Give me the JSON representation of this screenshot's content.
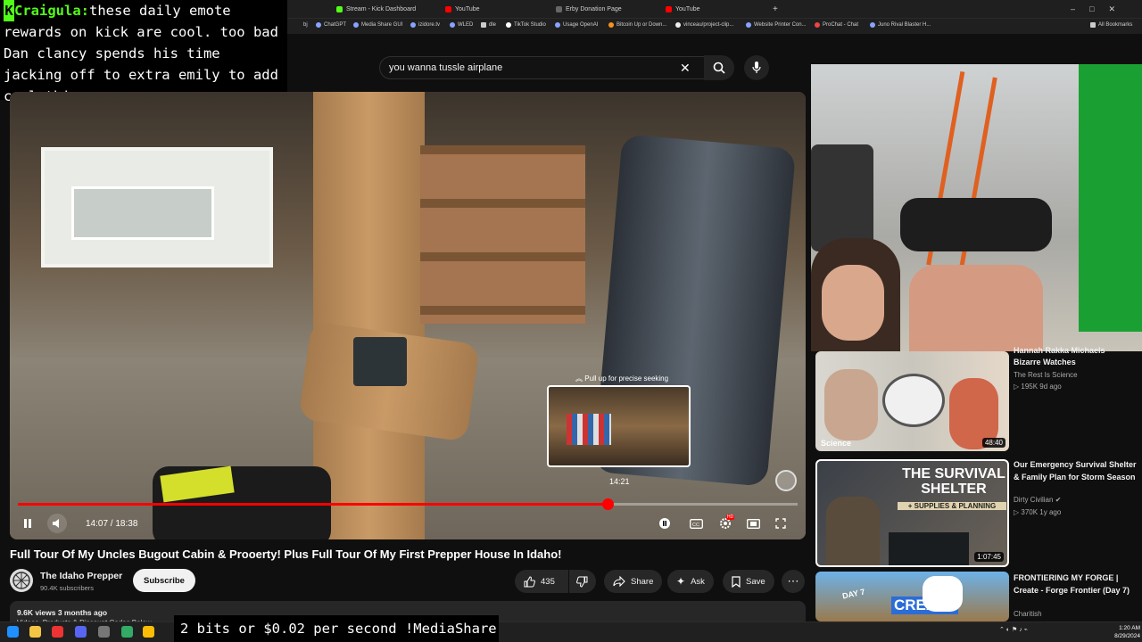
{
  "browser": {
    "tabs": [
      {
        "label": "Stream - Kick Dashboard",
        "color": "#53fc18"
      },
      {
        "label": "YouTube",
        "color": "#ff0000"
      },
      {
        "label": "Erby Donation Page",
        "color": "#888888"
      },
      {
        "label": "YouTube",
        "color": "#ff0000"
      }
    ],
    "bookmarks": [
      "bj",
      "ChatGPT",
      "Media Share GUI",
      "izidore.tv",
      "WLED",
      "dle",
      "TikTok Studio",
      "Usage  OpenAI",
      "Bitcoin Up or Down...",
      "vinceau/project-clip...",
      "Website Printer Con...",
      "ProChat - Chat",
      "Juno Rival Blaster H..."
    ],
    "all_bookmarks": "All Bookmarks"
  },
  "chat": {
    "username": "Craigula:",
    "message": "these daily emote rewards on kick are cool. too bad Dan clancy spends his time jacking off to extra emily to add cool things"
  },
  "search": {
    "query": "you wanna tussle airplane"
  },
  "player": {
    "time": "14:07 / 18:38",
    "progress": 0.756,
    "seek_hint": "Pull up for precise seeking",
    "preview_time": "14:21",
    "hd_badge": "HD"
  },
  "video": {
    "title": "Full Tour Of My Uncles Bugout Cabin & Prooerty! Plus Full Tour Of My First Prepper House In Idaho!",
    "channel": "The Idaho Prepper",
    "subscribers": "90.4K subscribers",
    "subscribe_label": "Subscribe",
    "likes": "435",
    "share_label": "Share",
    "ask_label": "Ask",
    "save_label": "Save",
    "views_line": "9.6K views  3 months ago",
    "desc_cut": "Videos, Products & Discount Codes Below"
  },
  "recommendations": [
    {
      "title_top": "Hannah Rakka Michaels",
      "title": "Bizarre Watches",
      "channel": "The Rest Is Science",
      "meta": "▷ 195K   9d ago",
      "duration": "48:40",
      "thumb_text": "Science"
    },
    {
      "title": "Our Emergency Survival Shelter & Family Plan for Storm Season",
      "channel": "Dirty Civilian",
      "meta": "▷ 370K   1y ago",
      "duration": "1:07:45",
      "thumb_text": "THE SURVIVAL SHELTER",
      "thumb_sub": "+ SUPPLIES & PLANNING"
    },
    {
      "title": "FRONTIERING MY FORGE | Create - Forge Frontier (Day 7)",
      "channel": "Charitish",
      "meta": "",
      "duration": "",
      "thumb_text": "CREATE",
      "thumb_sub": "DAY 7"
    }
  ],
  "overlay": {
    "media_share": "2 bits or $0.02 per second !MediaShare"
  },
  "clock": {
    "time": "1:20 AM",
    "date": "8/29/2024"
  }
}
